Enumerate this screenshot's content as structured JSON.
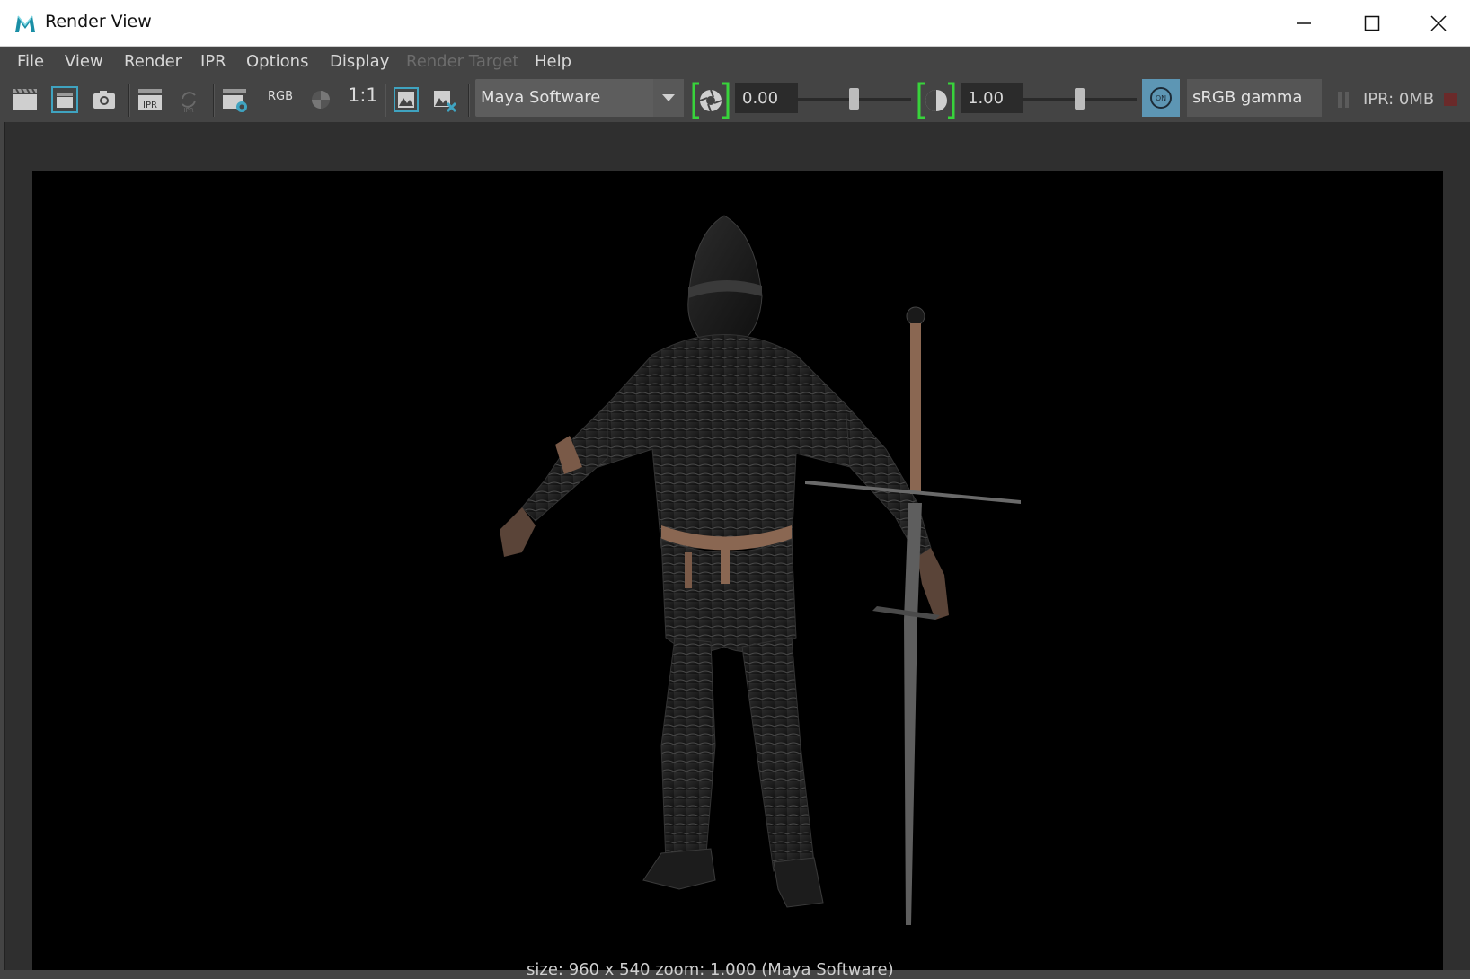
{
  "window": {
    "title": "Render View"
  },
  "menu": {
    "items": [
      {
        "label": "File"
      },
      {
        "label": "View"
      },
      {
        "label": "Render"
      },
      {
        "label": "IPR"
      },
      {
        "label": "Options"
      },
      {
        "label": "Display"
      },
      {
        "label": "Render Target",
        "disabled": true
      },
      {
        "label": "Help"
      }
    ]
  },
  "toolbar": {
    "rgb_label": "RGB",
    "ratio_label": "1:1",
    "renderer": "Maya Software",
    "exposure": "0.00",
    "gamma": "1.00",
    "exposure_level": 0.5,
    "gamma_level": 0.5,
    "color_mgmt_toggle": "ON",
    "view_transform": "sRGB gamma",
    "ipr_memory": "IPR: 0MB"
  },
  "render": {
    "status_text": "size: 960 x 540 zoom: 1.000 (Maya Software)"
  },
  "colors": {
    "accent_on": "#5d96b4",
    "highlight_green": "#38d33b",
    "panel_bg": "#444444",
    "view_bg": "#2f2f2f",
    "strap_leather": "#8a6752"
  },
  "icons": [
    "maya-app-icon",
    "render-current-frame-icon",
    "redo-previous-render-icon",
    "snapshot-icon",
    "ipr-render-icon",
    "refresh-ipr-icon",
    "render-settings-icon",
    "rgb-channels-icon",
    "alpha-channel-icon",
    "real-size-icon",
    "keep-image-icon",
    "remove-image-icon",
    "exposure-icon",
    "gamma-icon",
    "pause-icon",
    "stop-icon"
  ]
}
